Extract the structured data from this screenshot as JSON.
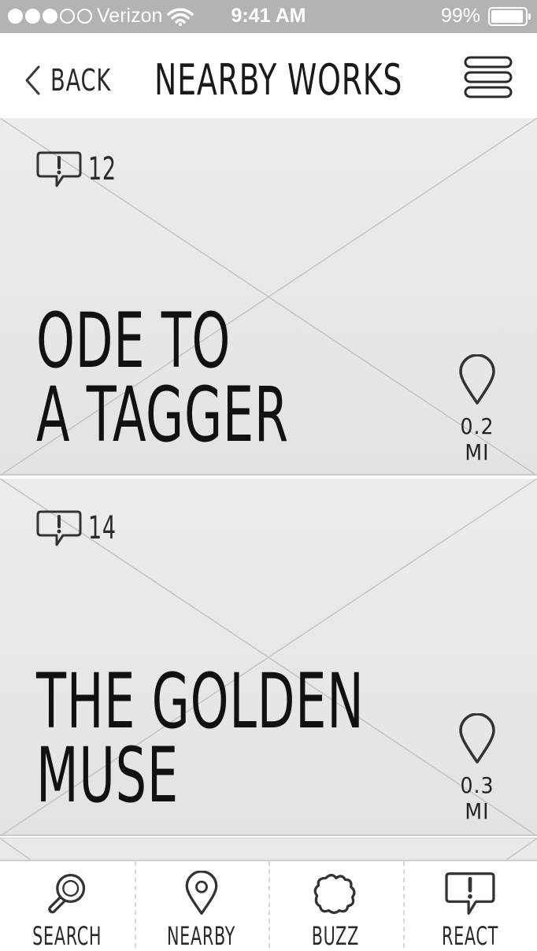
{
  "status_bar": {
    "carrier": "Verizon",
    "time": "9:41 AM",
    "battery": "99%",
    "signal_bars_filled": 3,
    "signal_bars_total": 5
  },
  "nav": {
    "back_label": "BACK",
    "title": "NEARBY WORKS"
  },
  "works": [
    {
      "comments": "12",
      "title_line1": "ODE TO",
      "title_line2": "A TAGGER",
      "distance": "0.2 MI"
    },
    {
      "comments": "14",
      "title_line1": "THE GOLDEN",
      "title_line2": "MUSE",
      "distance": "0.3 MI"
    }
  ],
  "tabs": [
    {
      "label": "SEARCH",
      "icon": "magnifier-icon"
    },
    {
      "label": "NEARBY",
      "icon": "map-pin-icon"
    },
    {
      "label": "BUZZ",
      "icon": "cloud-burst-icon"
    },
    {
      "label": "REACT",
      "icon": "exclamation-bubble-icon"
    }
  ],
  "colors": {
    "status_bar": "#b3b3b3",
    "card_fill": "#e7e7e7",
    "ink": "#1a1a1a"
  }
}
